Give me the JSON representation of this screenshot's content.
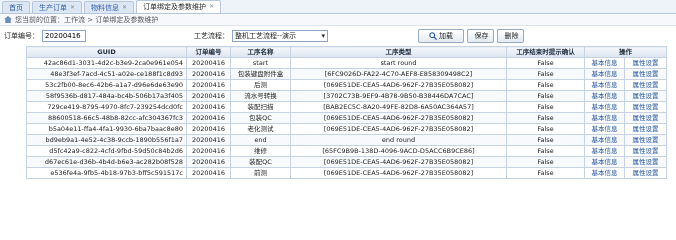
{
  "tabs": [
    {
      "label": "首页",
      "active": false
    },
    {
      "label": "生产订单",
      "active": false
    },
    {
      "label": "物料信息",
      "active": false
    },
    {
      "label": "订单绑定及参数维护",
      "active": true
    }
  ],
  "breadcrumb": {
    "text": "您当前的位置：工作流 > 订单绑定及参数维护"
  },
  "filter": {
    "order_label": "订单编号：",
    "order_value": "20200416",
    "process_label": "工艺流程：",
    "process_value": "整机工艺流程--演示",
    "add_label": "加载",
    "save_label": "保存",
    "delete_label": "删除"
  },
  "table": {
    "headers": [
      "GUID",
      "订单编号",
      "工序名称",
      "工序类型",
      "工序结束时提示确认",
      "操作"
    ],
    "basic_label": "基本信息",
    "attr_label": "属性设置",
    "rows": [
      {
        "guid": "42ac86d1-3031-4d2c-b3e9-2ca0e961e054",
        "order": "20200416",
        "name": "start",
        "type": "start round",
        "confirm": "False"
      },
      {
        "guid": "48e3f3ef-7acd-4c51-a02e-ce188f1c8d93",
        "order": "20200416",
        "name": "包装键盘附件盒",
        "type": "[6FC9026D-FA22-4C70-AEF8-E858309498C2]",
        "confirm": "False"
      },
      {
        "guid": "53c2fb00-8ec6-42b6-a1a7-d96e6de63e90",
        "order": "20200416",
        "name": "后测",
        "type": "[069E51DE-CEA5-4AD6-962F-27B35E058082]",
        "confirm": "False"
      },
      {
        "guid": "58f9536b-d817-484a-bc4b-506b17a3f405",
        "order": "20200416",
        "name": "流水号转换",
        "type": "[3702C73B-9EF9-4B78-9B50-B38446DA7CAC]",
        "confirm": "False"
      },
      {
        "guid": "729ce419-8795-4970-8fc7-239254dcd0fc",
        "order": "20200416",
        "name": "装配扫描",
        "type": "[BAB2EC5C-8A20-49FE-82D8-6A50AC364A57]",
        "confirm": "False"
      },
      {
        "guid": "88600518-66c5-48b8-82cc-afc304367fc3",
        "order": "20200416",
        "name": "包装QC",
        "type": "[069E51DE-CEA5-4AD6-962F-27B35E058082]",
        "confirm": "False"
      },
      {
        "guid": "b5a04e11-ffa4-4fa1-9930-6ba7baac8e80",
        "order": "20200416",
        "name": "老化测试",
        "type": "[069E51DE-CEA5-4AD6-962F-27B35E058082]",
        "confirm": "False"
      },
      {
        "guid": "bd9eb9a1-4e52-4c38-9ccb-1890b556f1a7",
        "order": "20200416",
        "name": "end",
        "type": "end round",
        "confirm": "False"
      },
      {
        "guid": "d5fc42a9-c822-4cfd-9fbd-59d50c84b2d6",
        "order": "20200416",
        "name": "维修",
        "type": "[65FC9B9B-138D-4096-9ACD-D5ACC6B9CE86]",
        "confirm": "False"
      },
      {
        "guid": "d67ec61e-d36b-4b4d-b6e3-ac282b08f528",
        "order": "20200416",
        "name": "装配QC",
        "type": "[069E51DE-CEA5-4AD6-962F-27B35E058082]",
        "confirm": "False"
      },
      {
        "guid": "e536fe4a-9fb5-4b18-97b3-bff5c591517c",
        "order": "20200416",
        "name": "前测",
        "type": "[069E51DE-CEA5-4AD6-962F-27B35E058082]",
        "confirm": "False"
      }
    ]
  }
}
